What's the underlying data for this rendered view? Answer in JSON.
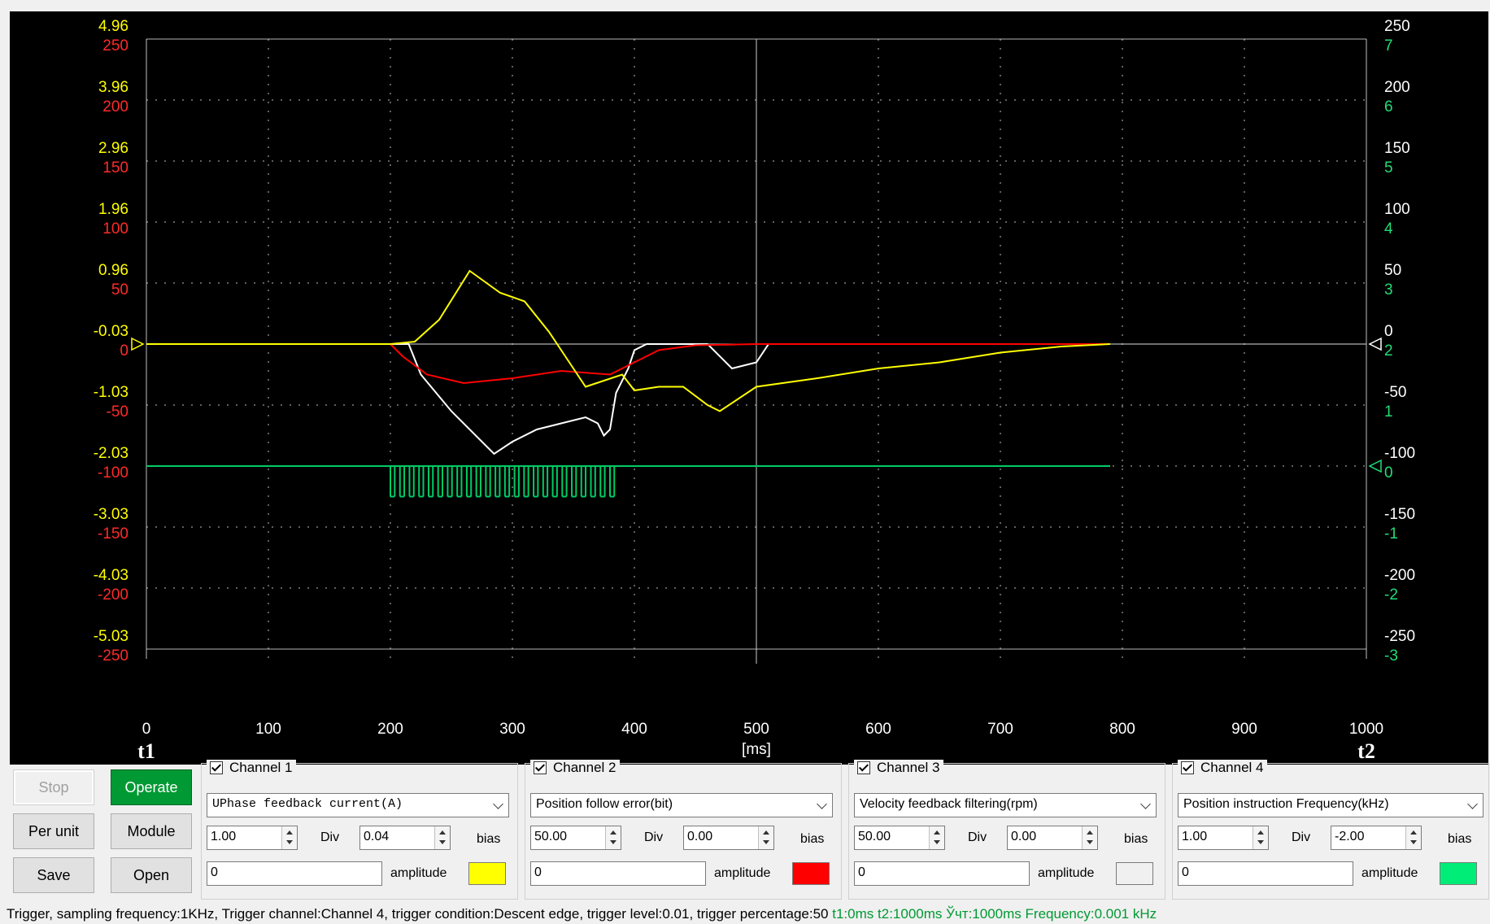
{
  "scope": {
    "left_axis_primary": [
      "4.96",
      "3.96",
      "2.96",
      "1.96",
      "0.96",
      "-0.03",
      "-1.03",
      "-2.03",
      "-3.03",
      "-4.03",
      "-5.03"
    ],
    "left_axis_secondary": [
      "250",
      "200",
      "150",
      "100",
      "50",
      "0",
      "-50",
      "-100",
      "-150",
      "-200",
      "-250"
    ],
    "right_axis_primary": [
      "250",
      "200",
      "150",
      "100",
      "50",
      "0",
      "-50",
      "-100",
      "-150",
      "-200",
      "-250"
    ],
    "right_axis_secondary": [
      "7",
      "6",
      "5",
      "4",
      "3",
      "2",
      "1",
      "0",
      "-1",
      "-2",
      "-3"
    ],
    "x_ticks": [
      "0",
      "100",
      "200",
      "300",
      "400",
      "500",
      "600",
      "700",
      "800",
      "900",
      "1000"
    ],
    "x_unit": "[ms]",
    "t1_label": "t1",
    "t2_label": "t2",
    "colors": {
      "background": "#000000",
      "ch1": "#ffff00",
      "ch2": "#ff0000",
      "ch3": "#ffffff",
      "ch4": "#00cc66",
      "grid": "#ffffff"
    }
  },
  "chart_data": {
    "type": "line",
    "xlabel": "[ms]",
    "xlim": [
      0,
      1000
    ],
    "ylim": [
      -250,
      250
    ],
    "series": [
      {
        "name": "Channel 1",
        "color": "#ffff00",
        "x": [
          0,
          200,
          220,
          240,
          265,
          290,
          310,
          330,
          350,
          360,
          375,
          390,
          400,
          420,
          440,
          460,
          470,
          500,
          550,
          600,
          650,
          700,
          750,
          790
        ],
        "y": [
          0,
          0,
          2,
          20,
          60,
          42,
          35,
          10,
          -20,
          -35,
          -30,
          -25,
          -38,
          -35,
          -35,
          -50,
          -55,
          -35,
          -28,
          -20,
          -15,
          -7,
          -2,
          0
        ]
      },
      {
        "name": "Channel 2",
        "color": "#ff0000",
        "x": [
          0,
          200,
          210,
          230,
          260,
          300,
          340,
          380,
          400,
          420,
          450,
          500,
          550,
          600,
          650,
          700,
          790
        ],
        "y": [
          0,
          0,
          -10,
          -25,
          -32,
          -28,
          -22,
          -25,
          -15,
          -5,
          -1,
          0,
          0,
          0,
          0,
          0,
          0
        ]
      },
      {
        "name": "Channel 3",
        "color": "#ffffff",
        "x": [
          0,
          215,
          225,
          250,
          280,
          285,
          300,
          320,
          340,
          360,
          370,
          375,
          380,
          385,
          395,
          400,
          410,
          420,
          460,
          480,
          500,
          510,
          790
        ],
        "y": [
          0,
          0,
          -25,
          -55,
          -85,
          -90,
          -80,
          -70,
          -65,
          -60,
          -65,
          -75,
          -70,
          -40,
          -20,
          -5,
          0,
          0,
          0,
          -20,
          -15,
          0,
          0
        ]
      },
      {
        "name": "Channel 4",
        "color": "#00cc66",
        "x": [
          0,
          790
        ],
        "y": [
          -100,
          -100
        ],
        "pulses": {
          "start": 200,
          "end": 380,
          "count": 24,
          "depth": -25
        }
      }
    ]
  },
  "buttons": {
    "stop": "Stop",
    "operate": "Operate",
    "per_unit": "Per unit",
    "module": "Module",
    "save": "Save",
    "open": "Open"
  },
  "channels": [
    {
      "title": "Channel 1",
      "signal": "UPhase feedback current(A)",
      "div": "1.00",
      "bias": "0.04",
      "amplitude": "0",
      "swatch": "#ffff00"
    },
    {
      "title": "Channel 2",
      "signal": "Position follow error(bit)",
      "div": "50.00",
      "bias": "0.00",
      "amplitude": "0",
      "swatch": "#ff0000"
    },
    {
      "title": "Channel 3",
      "signal": "Velocity feedback filtering(rpm)",
      "div": "50.00",
      "bias": "0.00",
      "amplitude": "0",
      "swatch": "#f0f0f0"
    },
    {
      "title": "Channel 4",
      "signal": "Position instruction Frequency(kHz)",
      "div": "1.00",
      "bias": "-2.00",
      "amplitude": "0",
      "swatch": "#00ee77"
    }
  ],
  "labels": {
    "div": "Div",
    "bias": "bias",
    "amplitude": "amplitude"
  },
  "status": {
    "main": "Trigger, sampling frequency:1KHz, Trigger channel:Channel 4, trigger condition:Descent edge, trigger level:0.01, trigger percentage:50",
    "t1": "t1:0ms",
    "t2": "t2:1000ms",
    "dt": "Ўчт:1000ms",
    "freq": "Frequency:0.001 kHz"
  }
}
